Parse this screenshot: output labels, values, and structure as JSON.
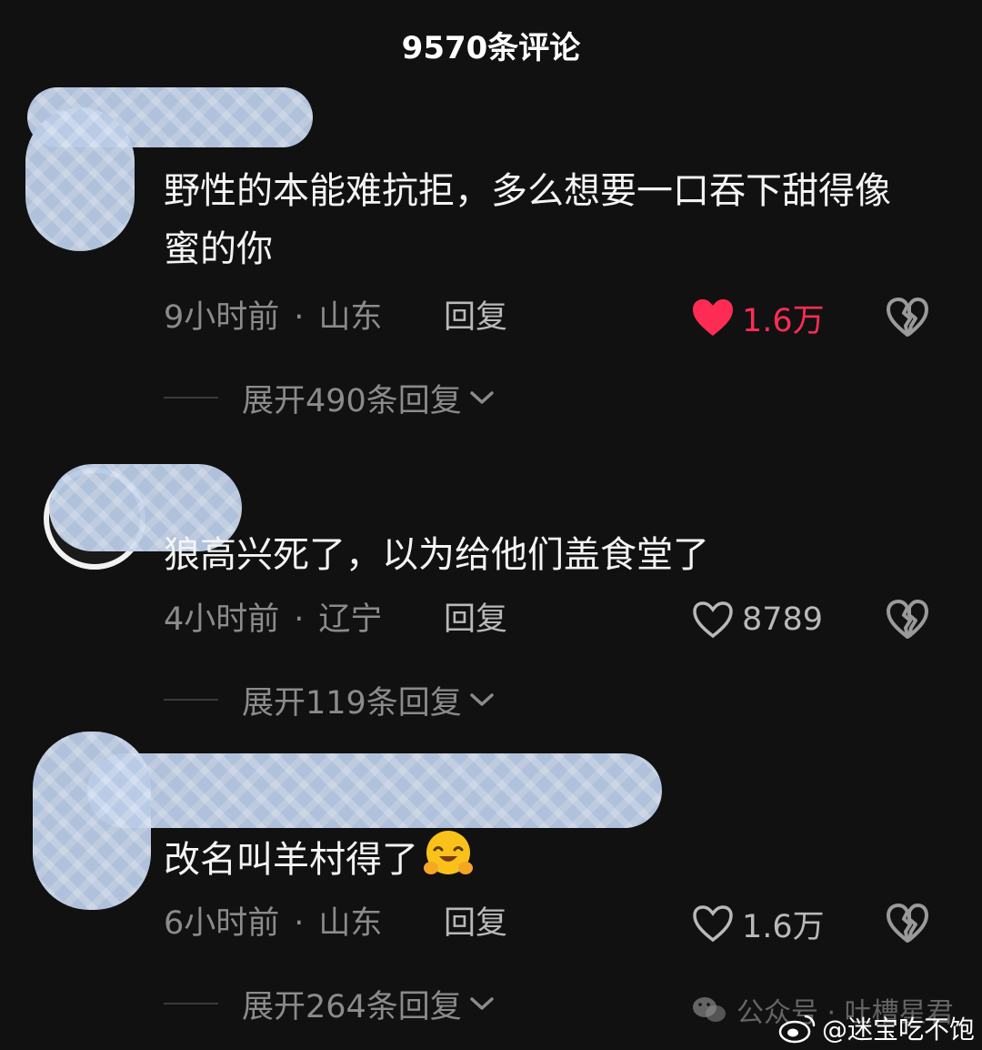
{
  "header": {
    "title": "9570条评论"
  },
  "colors": {
    "liked_red": "#fe2c55",
    "muted_gray": "#8b8b8b",
    "redaction_blue": "#b9cbe6"
  },
  "comments": [
    {
      "text": "野性的本能难抗拒，多么想要一口吞下甜得像蜜的你",
      "time": "9小时前",
      "separator": "·",
      "location": "山东",
      "reply_label": "回复",
      "likes": "1.6万",
      "liked": true,
      "expand_label": "展开490条回复"
    },
    {
      "text": "狼高兴死了，以为给他们盖食堂了",
      "time": "4小时前",
      "separator": "·",
      "location": "辽宁",
      "reply_label": "回复",
      "likes": "8789",
      "liked": false,
      "expand_label": "展开119条回复"
    },
    {
      "text": "改名叫羊村得了",
      "emoji": "smiling-face-with-open-hands",
      "time": "6小时前",
      "separator": "·",
      "location": "山东",
      "reply_label": "回复",
      "likes": "1.6万",
      "liked": false,
      "expand_label": "展开264条回复"
    }
  ],
  "icons": {
    "like": "heart-icon",
    "dislike": "broken-heart-icon",
    "expand": "chevron-down-icon",
    "wechat": "wechat-icon",
    "weibo": "weibo-icon"
  },
  "watermarks": {
    "wechat_text": "公众号 · 吐槽星君",
    "weibo_text": "@迷宝吃不饱"
  }
}
